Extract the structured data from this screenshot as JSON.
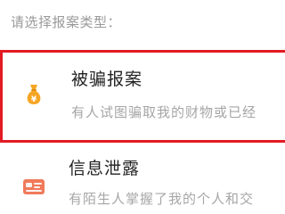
{
  "prompt": "请选择报案类型：",
  "options": [
    {
      "title": "被骗报案",
      "description": "有人试图骗取我的财物或已经",
      "icon": "money-bag-icon",
      "icon_color": "#f5a623",
      "selected": true
    },
    {
      "title": "信息泄露",
      "description": "有陌生人掌握了我的个人和交",
      "icon": "id-card-icon",
      "icon_color": "#f07a5a",
      "selected": false
    }
  ],
  "colors": {
    "selection_border": "#e21b23",
    "prompt_text": "#9a9a9a",
    "title_text": "#222222",
    "description_text": "#a6a6a6"
  }
}
